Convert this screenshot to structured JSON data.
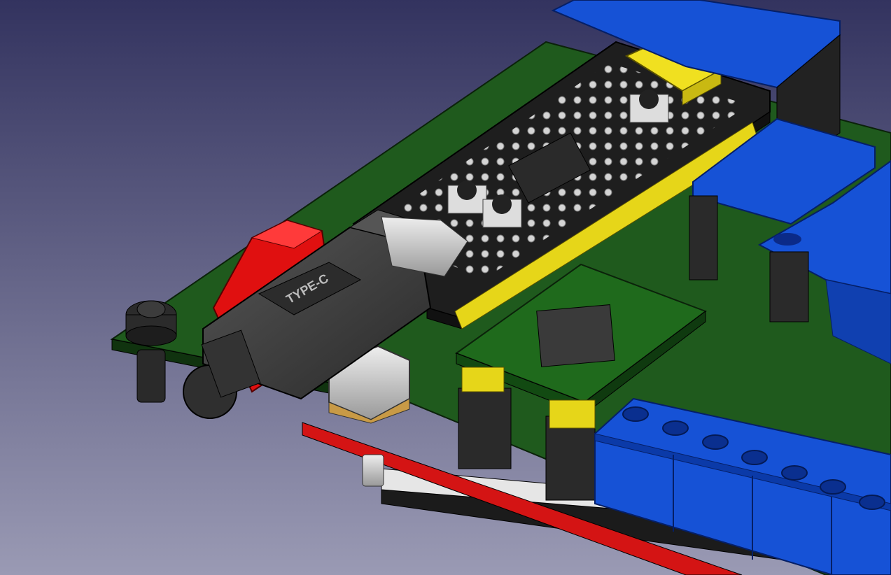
{
  "scene": {
    "description_label": "",
    "usb_plug_marking": "TYPE-C",
    "colors": {
      "background_top": "#33335f",
      "background_bottom": "#9a9ab4",
      "pcb_green": "#1f5a1d",
      "pcb_edge": "#0f2e0e",
      "mcu_board": "#1e1e1e",
      "terminal_blue": "#1652d6",
      "header_yellow": "#e6d619",
      "jumper_red": "#e01010",
      "plug_gray": "#3a3a3a",
      "pad_white": "#e8e8e8"
    }
  }
}
